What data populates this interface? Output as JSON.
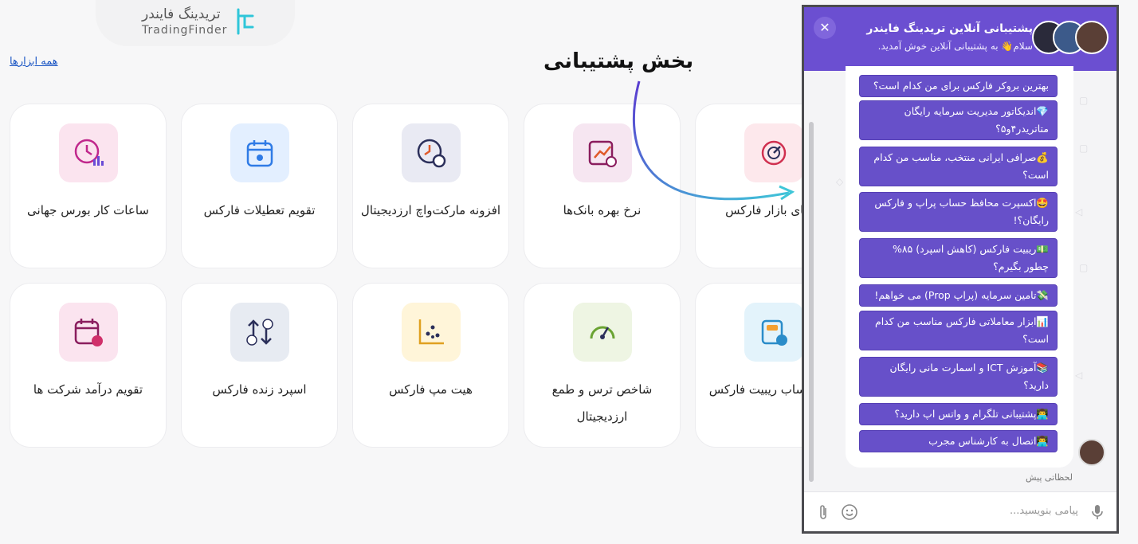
{
  "logo": {
    "fa": "تریدینگ فایندر",
    "en": "TradingFinder"
  },
  "all_tools": "همه ابزارها",
  "heading": "بخش پشتیبانی",
  "cards": [
    {
      "label": "ساعات کار بورس جهانی",
      "icon": "clock-chart-icon",
      "bg": "#fbe4ef"
    },
    {
      "label": "تقویم تعطیلات فارکس",
      "icon": "calendar-icon",
      "bg": "#e3efff"
    },
    {
      "label": "افزونه مارکت‌واچ ارزدیجیتال",
      "icon": "clock-coin-icon",
      "bg": "#e9eaf3"
    },
    {
      "label": "نرخ بهره بانک‌ها",
      "icon": "chart-percent-icon",
      "bg": "#f6e6f1"
    },
    {
      "label": "...های بازار فارکس",
      "icon": "target-clock-icon",
      "bg": "#fde8ec"
    },
    {
      "label": "تقویم درآمد شرکت ها",
      "icon": "calendar-dollar-icon",
      "bg": "#fbe4ef"
    },
    {
      "label": "اسپرد زنده فارکس",
      "icon": "buy-sell-icon",
      "bg": "#e7ebf2"
    },
    {
      "label": "هیت مپ فارکس",
      "icon": "scatter-icon",
      "bg": "#fff5d9"
    },
    {
      "label": "شاخص ترس و طمع ارزدیجیتال",
      "icon": "gauge-icon",
      "bg": "#eef5e3"
    },
    {
      "label": "...ن حساب ریبیت فارکس",
      "icon": "rebate-icon",
      "bg": "#e3f3fb"
    }
  ],
  "chat": {
    "title": "پشتیبانی آنلاین تریدینگ فایندر",
    "subtitle": "سلام👋 به پشتیبانی آنلاین خوش آمدید.",
    "close": "✕",
    "options": [
      "بهترین بروکر فارکس برای من کدام است؟",
      "💎اندیکاتور مدیریت سرمایه رایگان متاتریدر۴و۵؟",
      "💰صرافی ایرانی منتخب، مناسب من کدام است؟",
      "🤩اکسپرت محافظ حساب پراپ و فارکس رایگان؟!",
      "💵ریبیت فارکس (کاهش اسپرد) ۸۵% چطور بگیرم؟",
      "💸تامین سرمایه (پراپ Prop) می خواهم!",
      "📊ابزار معاملاتی فارکس مناسب من کدام است؟",
      "📚آموزش ICT و اسمارت مانی رایگان دارید؟",
      "👨‍💻پشتیبانی تلگرام و واتس اپ دارید؟",
      "👨‍💻اتصال به کارشناس مجرب"
    ],
    "time": "لحظاتی پیش",
    "input_placeholder": "پیامی بنویسید..."
  }
}
